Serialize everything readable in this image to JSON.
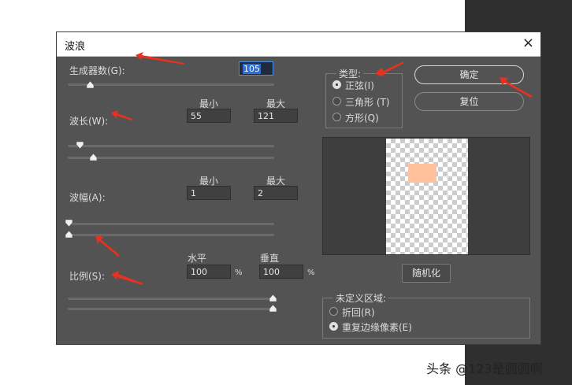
{
  "dialog": {
    "title": "波浪",
    "close_glyph": "×"
  },
  "generators": {
    "label": "生成器数(G):",
    "value_selected": "105",
    "slider_fraction": 0.1
  },
  "wavelength": {
    "label": "波长(W):",
    "min_header": "最小",
    "max_header": "最大",
    "min_value": "55",
    "max_value": "121"
  },
  "amplitude": {
    "label": "波幅(A):",
    "min_header": "最小",
    "max_header": "最大",
    "min_value": "1",
    "max_value": "2"
  },
  "scale": {
    "label": "比例(S):",
    "horizontal_header": "水平",
    "vertical_header": "垂直",
    "horizontal_value": "100",
    "vertical_value": "100",
    "unit": "%"
  },
  "type_group": {
    "title": "类型:",
    "options": [
      {
        "label": "正弦(I)",
        "selected": true
      },
      {
        "label": "三角形 (T)",
        "selected": false
      },
      {
        "label": "方形(Q)",
        "selected": false
      }
    ]
  },
  "buttons": {
    "ok": "确定",
    "reset": "复位",
    "randomize": "随机化"
  },
  "undefined_area": {
    "title": "未定义区域:",
    "options": [
      {
        "label": "折回(R)",
        "selected": false
      },
      {
        "label": "重复边缘像素(E)",
        "selected": true
      }
    ]
  },
  "watermark": "头条 @123是圆圆啊",
  "colors": {
    "dialog_bg": "#535353",
    "preview_swatch": "#ffc09a",
    "arrow": "#e8311f",
    "selection": "#2d6dd6"
  }
}
